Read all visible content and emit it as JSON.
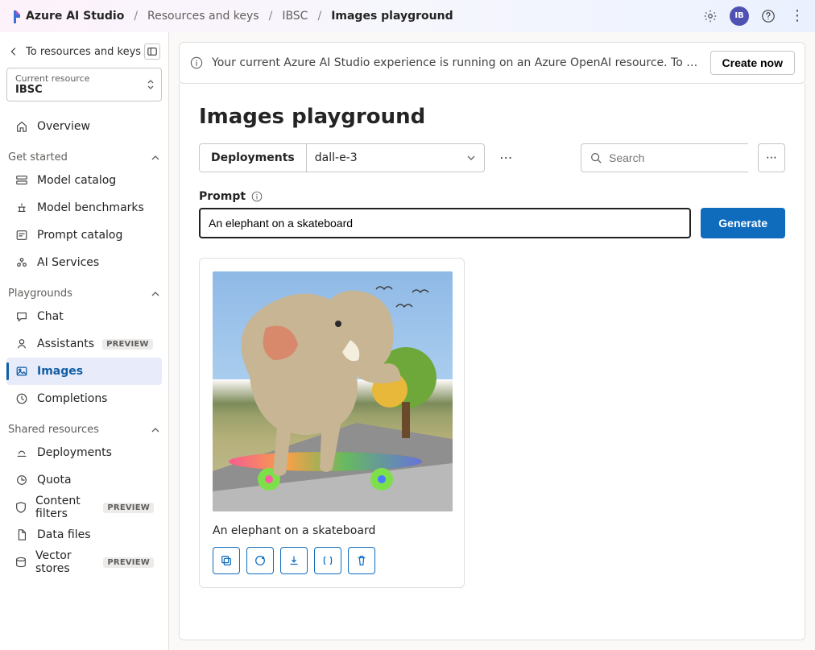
{
  "header": {
    "app_name": "Azure AI Studio",
    "breadcrumbs": [
      "Resources and keys",
      "IBSC",
      "Images playground"
    ],
    "avatar_initials": "IB"
  },
  "sidebar": {
    "back_label": "To resources and keys",
    "resource_card": {
      "label": "Current resource",
      "value": "IBSC"
    },
    "top_items": [
      {
        "icon": "home-icon",
        "label": "Overview"
      }
    ],
    "groups": [
      {
        "title": "Get started",
        "items": [
          {
            "icon": "catalog-icon",
            "label": "Model catalog"
          },
          {
            "icon": "benchmark-icon",
            "label": "Model benchmarks"
          },
          {
            "icon": "prompt-icon",
            "label": "Prompt catalog"
          },
          {
            "icon": "ai-services-icon",
            "label": "AI Services"
          }
        ]
      },
      {
        "title": "Playgrounds",
        "items": [
          {
            "icon": "chat-icon",
            "label": "Chat"
          },
          {
            "icon": "assistant-icon",
            "label": "Assistants",
            "preview": true
          },
          {
            "icon": "images-icon",
            "label": "Images",
            "active": true
          },
          {
            "icon": "completions-icon",
            "label": "Completions"
          }
        ]
      },
      {
        "title": "Shared resources",
        "items": [
          {
            "icon": "deploy-icon",
            "label": "Deployments"
          },
          {
            "icon": "quota-icon",
            "label": "Quota"
          },
          {
            "icon": "shield-icon",
            "label": "Content filters",
            "preview": true
          },
          {
            "icon": "file-icon",
            "label": "Data files"
          },
          {
            "icon": "vector-icon",
            "label": "Vector stores",
            "preview": true
          }
        ]
      }
    ],
    "preview_badge": "PREVIEW"
  },
  "banner": {
    "message": "Your current Azure AI Studio experience is running on an Azure OpenAI resource. To unlock all capabilities, create a...",
    "cta": "Create now"
  },
  "page": {
    "title": "Images playground",
    "deployments_label": "Deployments",
    "deployment_selected": "dall-e-3",
    "search_placeholder": "Search",
    "prompt_label": "Prompt",
    "prompt_value": "An elephant on a skateboard",
    "generate_label": "Generate",
    "result": {
      "caption": "An elephant on a skateboard",
      "actions": [
        "copy",
        "regenerate",
        "download",
        "view-json",
        "delete"
      ]
    }
  }
}
